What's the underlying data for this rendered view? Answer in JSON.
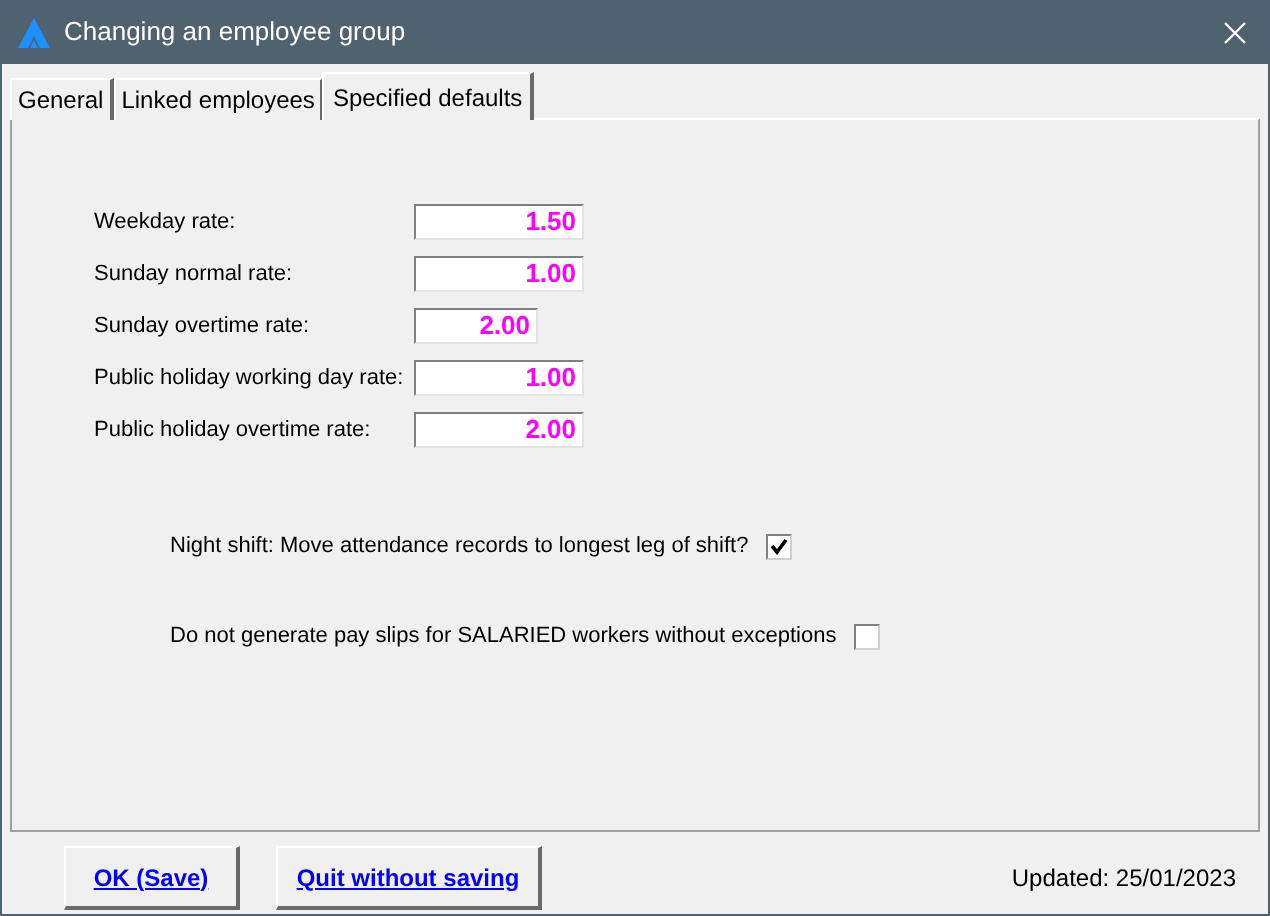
{
  "window": {
    "title": "Changing an employee group"
  },
  "tabs": [
    {
      "label": "General",
      "selected": false
    },
    {
      "label": "Linked employees",
      "selected": false
    },
    {
      "label": "Specified defaults",
      "selected": true
    }
  ],
  "rates": [
    {
      "label": "Weekday rate:",
      "value": "1.50",
      "short": false
    },
    {
      "label": "Sunday normal rate:",
      "value": "1.00",
      "short": false
    },
    {
      "label": "Sunday overtime rate:",
      "value": "2.00",
      "short": true
    },
    {
      "label": "Public holiday working day rate:",
      "value": "1.00",
      "short": false
    },
    {
      "label": "Public holiday overtime rate:",
      "value": "2.00",
      "short": false
    }
  ],
  "options": [
    {
      "label": "Night shift: Move attendance records to longest leg of shift?",
      "checked": true
    },
    {
      "label": "Do not generate pay slips for SALARIED workers without exceptions",
      "checked": false
    }
  ],
  "buttons": [
    {
      "label": "OK (Save)"
    },
    {
      "label": "Quit without saving"
    }
  ],
  "status": "Updated: 25/01/2023"
}
